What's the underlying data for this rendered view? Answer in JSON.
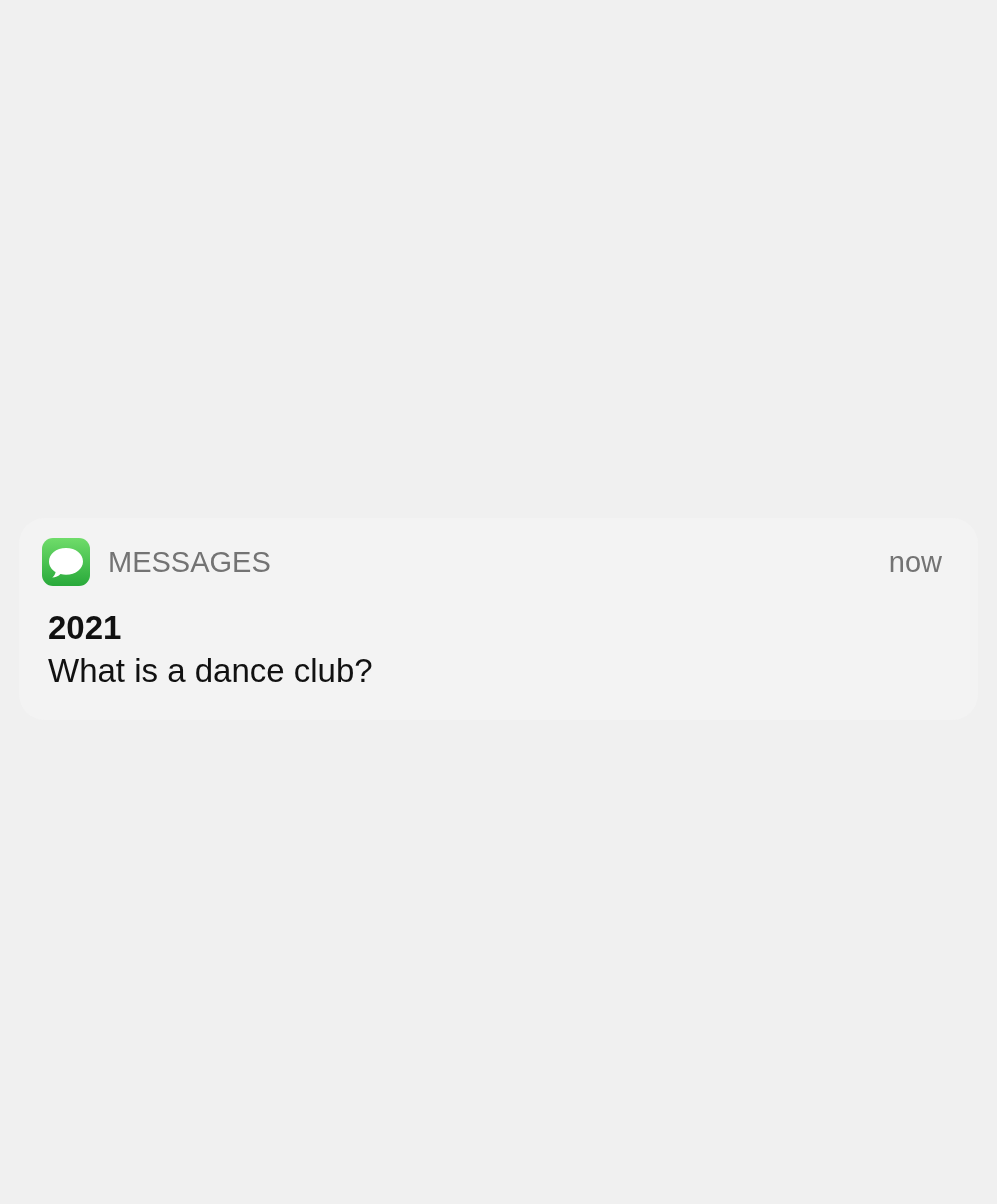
{
  "notification": {
    "app_name": "MESSAGES",
    "time": "now",
    "title": "2021",
    "body": "What is a dance club?"
  }
}
